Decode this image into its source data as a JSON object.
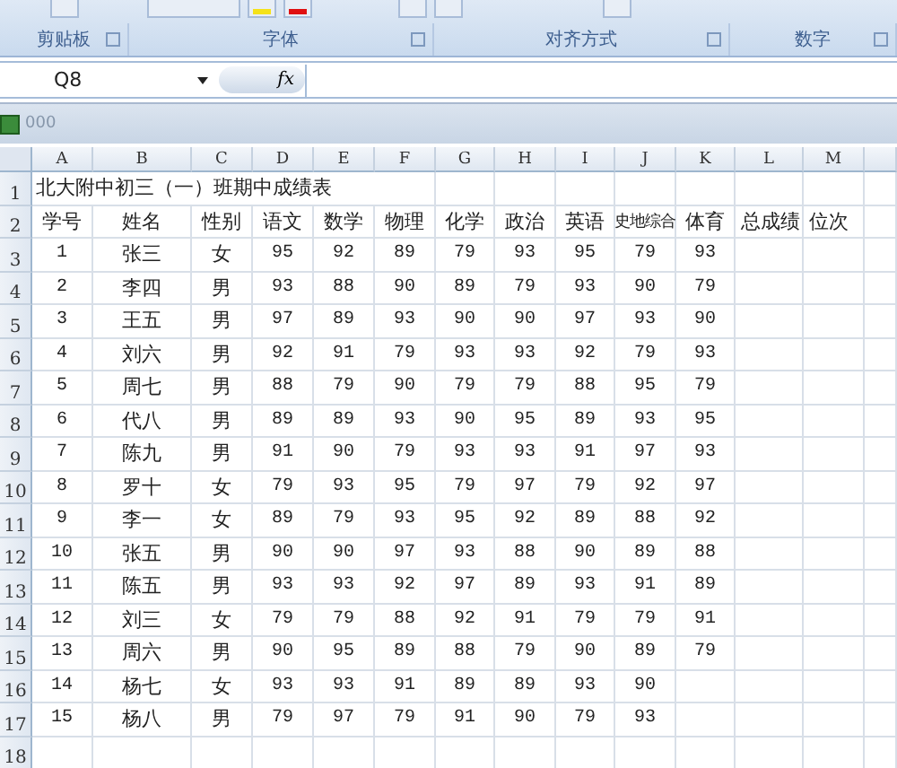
{
  "ribbon": {
    "groups": [
      {
        "label": "剪贴板"
      },
      {
        "label": "字体"
      },
      {
        "label": "对齐方式"
      },
      {
        "label": "数字"
      }
    ]
  },
  "formula_bar": {
    "name_box": "Q8",
    "fx": "fx"
  },
  "workbook": {
    "title": "000"
  },
  "sheet": {
    "columns": [
      "A",
      "B",
      "C",
      "D",
      "E",
      "F",
      "G",
      "H",
      "I",
      "J",
      "K",
      "L",
      "M"
    ],
    "row_numbers": [
      "1",
      "2",
      "3",
      "4",
      "5",
      "6",
      "7",
      "8",
      "9",
      "10",
      "11",
      "12",
      "13",
      "14",
      "15",
      "16",
      "17",
      "18"
    ],
    "title": "北大附中初三（一）班期中成绩表",
    "headers": [
      "学号",
      "姓名",
      "性别",
      "语文",
      "数学",
      "物理",
      "化学",
      "政治",
      "英语",
      "史地综合",
      "体育",
      "总成绩",
      "位次"
    ],
    "rows": [
      [
        "1",
        "张三",
        "女",
        "95",
        "92",
        "89",
        "79",
        "93",
        "95",
        "79",
        "93"
      ],
      [
        "2",
        "李四",
        "男",
        "93",
        "88",
        "90",
        "89",
        "79",
        "93",
        "90",
        "79"
      ],
      [
        "3",
        "王五",
        "男",
        "97",
        "89",
        "93",
        "90",
        "90",
        "97",
        "93",
        "90"
      ],
      [
        "4",
        "刘六",
        "男",
        "92",
        "91",
        "79",
        "93",
        "93",
        "92",
        "79",
        "93"
      ],
      [
        "5",
        "周七",
        "男",
        "88",
        "79",
        "90",
        "79",
        "79",
        "88",
        "95",
        "79"
      ],
      [
        "6",
        "代八",
        "男",
        "89",
        "89",
        "93",
        "90",
        "95",
        "89",
        "93",
        "95"
      ],
      [
        "7",
        "陈九",
        "男",
        "91",
        "90",
        "79",
        "93",
        "93",
        "91",
        "97",
        "93"
      ],
      [
        "8",
        "罗十",
        "女",
        "79",
        "93",
        "95",
        "79",
        "97",
        "79",
        "92",
        "97"
      ],
      [
        "9",
        "李一",
        "女",
        "89",
        "79",
        "93",
        "95",
        "92",
        "89",
        "88",
        "92"
      ],
      [
        "10",
        "张五",
        "男",
        "90",
        "90",
        "97",
        "93",
        "88",
        "90",
        "89",
        "88"
      ],
      [
        "11",
        "陈五",
        "男",
        "93",
        "93",
        "92",
        "97",
        "89",
        "93",
        "91",
        "89"
      ],
      [
        "12",
        "刘三",
        "女",
        "79",
        "79",
        "88",
        "92",
        "91",
        "79",
        "79",
        "91"
      ],
      [
        "13",
        "周六",
        "男",
        "90",
        "95",
        "89",
        "88",
        "79",
        "90",
        "89",
        "79"
      ],
      [
        "14",
        "杨七",
        "女",
        "93",
        "93",
        "91",
        "89",
        "89",
        "93",
        "90"
      ],
      [
        "15",
        "杨八",
        "男",
        "79",
        "97",
        "79",
        "91",
        "90",
        "79",
        "93"
      ]
    ]
  }
}
